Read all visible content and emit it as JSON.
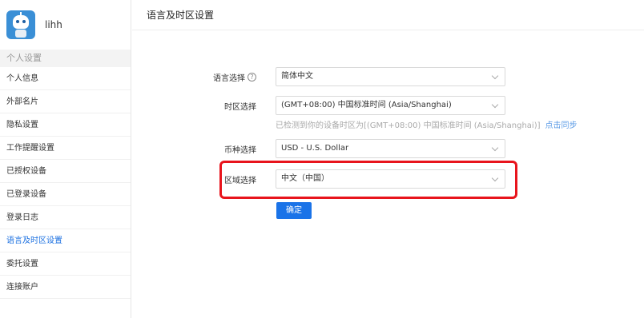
{
  "user": {
    "name": "lihh"
  },
  "sidebar": {
    "section_title": "个人设置",
    "items": [
      {
        "label": "个人信息"
      },
      {
        "label": "外部名片"
      },
      {
        "label": "隐私设置"
      },
      {
        "label": "工作提醒设置"
      },
      {
        "label": "已授权设备"
      },
      {
        "label": "已登录设备"
      },
      {
        "label": "登录日志"
      },
      {
        "label": "语言及时区设置",
        "active": true
      },
      {
        "label": "委托设置"
      },
      {
        "label": "连接账户"
      }
    ]
  },
  "page": {
    "title": "语言及时区设置",
    "language": {
      "label": "语言选择",
      "value": "简体中文"
    },
    "timezone": {
      "label": "时区选择",
      "value": "(GMT+08:00) 中国标准时间 (Asia/Shanghai)",
      "hint": "已检测到你的设备时区为[(GMT+08:00) 中国标准时间 (Asia/Shanghai)]",
      "sync_link": "点击同步"
    },
    "currency": {
      "label": "币种选择",
      "value": "USD - U.S. Dollar"
    },
    "region": {
      "label": "区域选择",
      "value": "中文（中国）"
    },
    "confirm_label": "确定"
  },
  "colors": {
    "accent": "#1a73e8",
    "highlight": "#e8141c",
    "active_menu": "#1a6fe0"
  }
}
